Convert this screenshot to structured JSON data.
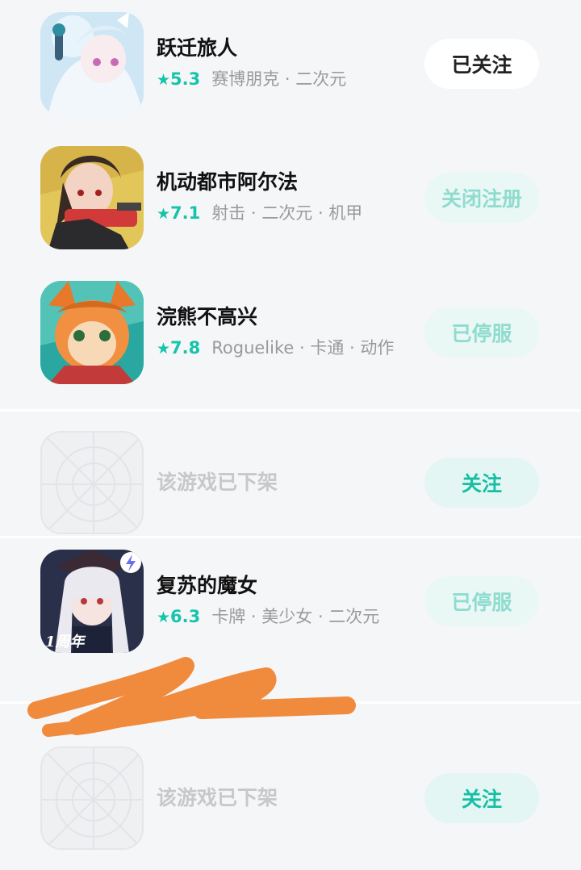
{
  "games": [
    {
      "title": "跃迁旅人",
      "score": "5.3",
      "tags": "赛博朋克 · 二次元",
      "button": "已关注",
      "icon": "game-icon-yueqian"
    },
    {
      "title": "机动都市阿尔法",
      "score": "7.1",
      "tags": "射击 · 二次元 · 机甲",
      "button": "关闭注册",
      "icon": "game-icon-jidong"
    },
    {
      "title": "浣熊不高兴",
      "score": "7.8",
      "tags": "Roguelike · 卡通 · 动作",
      "button": "已停服",
      "icon": "game-icon-huanxiong"
    },
    {
      "removed_text": "该游戏已下架",
      "button": "关注",
      "icon": "placeholder-icon"
    },
    {
      "title": "复苏的魔女",
      "score": "6.3",
      "tags": "卡牌 · 美少女 · 二次元",
      "button": "已停服",
      "icon": "game-icon-fusu",
      "badge": "1周年"
    },
    {
      "removed_text": "该游戏已下架",
      "button": "关注",
      "icon": "placeholder-icon"
    }
  ],
  "star_glyph": "★",
  "colors": {
    "accent": "#16c4aa",
    "button_disabled_text": "#8fdccf",
    "button_follow_bg": "#e3f6f3"
  }
}
